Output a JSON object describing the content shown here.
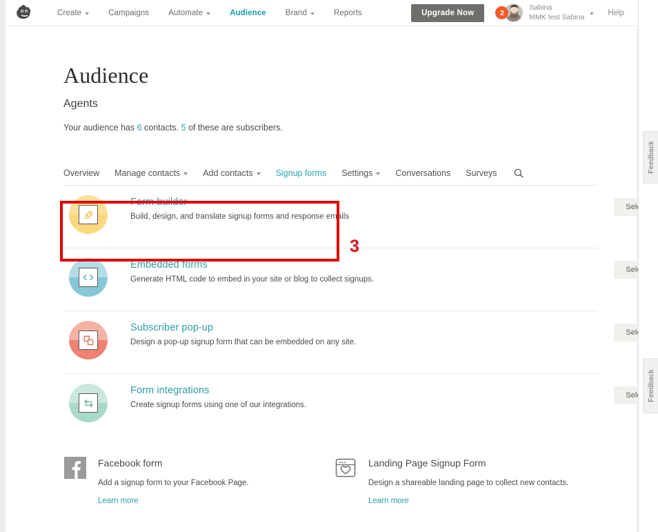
{
  "topnav": {
    "logo_icon": "mailchimp-freddie-logo",
    "items": [
      {
        "label": "Create",
        "has_caret": true,
        "active": false
      },
      {
        "label": "Campaigns",
        "has_caret": false,
        "active": false
      },
      {
        "label": "Automate",
        "has_caret": true,
        "active": false
      },
      {
        "label": "Audience",
        "has_caret": false,
        "active": true
      },
      {
        "label": "Brand",
        "has_caret": true,
        "active": false
      },
      {
        "label": "Reports",
        "has_caret": false,
        "active": false
      }
    ],
    "upgrade_label": "Upgrade Now",
    "notification_count": "2",
    "avatar_icon": "user-avatar",
    "user_name": "Sabina",
    "user_account": "MMK test Sabina",
    "help_label": "Help",
    "search_icon": "search-icon",
    "active_color": "#13a0a8",
    "upgrade_bg": "#706e6b",
    "badge_color": "#f15a2b"
  },
  "page": {
    "title": "Audience",
    "list_name": "Agents",
    "stats_prefix": "Your audience has ",
    "stats_contacts": "6",
    "stats_mid": " contacts. ",
    "stats_subscribers": "5",
    "stats_suffix": " of these are subscribers."
  },
  "tabs": [
    {
      "label": "Overview",
      "has_caret": false,
      "active": false
    },
    {
      "label": "Manage contacts",
      "has_caret": true,
      "active": false
    },
    {
      "label": "Add contacts",
      "has_caret": true,
      "active": false
    },
    {
      "label": "Signup forms",
      "has_caret": false,
      "active": true
    },
    {
      "label": "Settings",
      "has_caret": true,
      "active": false
    },
    {
      "label": "Conversations",
      "has_caret": false,
      "active": false
    },
    {
      "label": "Surveys",
      "has_caret": false,
      "active": false
    }
  ],
  "tab_search_icon": "search-icon",
  "options": [
    {
      "title": "Form builder",
      "description": "Build, design, and translate signup forms and response emails",
      "icon": "link-chain-icon",
      "circle_top": "#fce09a",
      "circle_bottom": "#fbd87f",
      "glyph_color": "#f5c14e",
      "select_label": "Select"
    },
    {
      "title": "Embedded forms",
      "description": "Generate HTML code to embed in your site or blog to collect signups.",
      "icon": "code-brackets-icon",
      "circle_top": "#b4dde8",
      "circle_bottom": "#86c7d8",
      "glyph_color": "#4aa8c0",
      "select_label": "Select"
    },
    {
      "title": "Subscriber pop-up",
      "description": "Design a pop-up signup form that can be embedded on any site.",
      "icon": "pop-up-windows-icon",
      "circle_top": "#f4b2a4",
      "circle_bottom": "#ef8272",
      "glyph_color": "#e8705c",
      "select_label": "Select"
    },
    {
      "title": "Form integrations",
      "description": "Create signup forms using one of our integrations.",
      "icon": "arrows-exchange-icon",
      "circle_top": "#cbe8de",
      "circle_bottom": "#a9d9cb",
      "glyph_color": "#6aa99a",
      "select_label": "Select"
    }
  ],
  "bottom_cards": [
    {
      "title": "Facebook form",
      "description": "Add a signup form to your Facebook Page.",
      "link_label": "Learn more",
      "icon": "facebook-icon"
    },
    {
      "title": "Landing Page Signup Form",
      "description": "Design a shareable landing page to collect new contacts.",
      "link_label": "Learn more",
      "icon": "landing-page-heart-icon"
    }
  ],
  "annotation": {
    "number": "3",
    "color": "#d71920",
    "box_color": "#e00000"
  },
  "feedback_tabs": [
    {
      "label": "Feedback"
    },
    {
      "label": "Feedback"
    }
  ]
}
